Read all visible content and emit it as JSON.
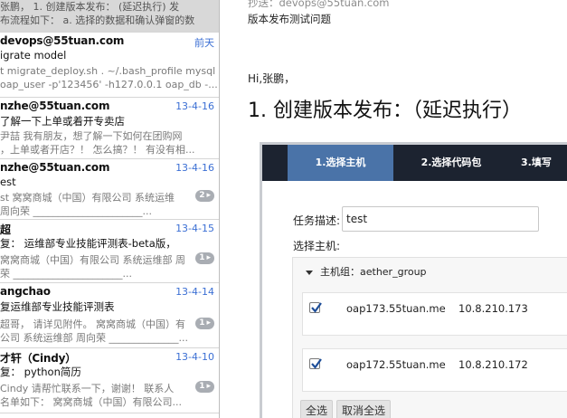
{
  "messages": [
    {
      "from": "",
      "date": "",
      "subject": "",
      "preview": [
        "张鹏， 1. 创建版本发布： (延迟执行) 发",
        "布流程如下： a. 选择的数据和确认弹窗的数"
      ],
      "count": ""
    },
    {
      "from": "devops@55tuan.com",
      "date": "前天",
      "subject": "igrate model",
      "preview": [
        "t migrate_deploy.sh . ~/.bash_profile mysql -",
        "oap_user -p'123456' -h127.0.0.1 oap_db -..."
      ],
      "count": ""
    },
    {
      "from": "nzhe@55tuan.com",
      "date": "13-4-16",
      "subject": "了解一下上单或着开专卖店",
      "preview": [
        "尹喆 我有朋友，想了解一下如何在团购网",
        "，上单或者开店？！ 怎么搞？！ 有没有相..."
      ],
      "count": ""
    },
    {
      "from": "nzhe@55tuan.com",
      "date": "13-4-16",
      "subject": "est",
      "preview": [
        "st 窝窝商城（中国）有限公司 系统运维",
        "周向荣 ______________________..."
      ],
      "count": "2"
    },
    {
      "from": "超",
      "date": "13-4-15",
      "subject": "复： 运维部专业技能评测表-beta版，",
      "preview": [
        "窝窝商城（中国）有限公司 系统运维部 周",
        "荣 ______________________..."
      ],
      "count": "1"
    },
    {
      "from": "angchao",
      "date": "13-4-14",
      "subject": "复运维部专业技能评测表",
      "preview": [
        "超哥， 请详见附件。 窝窝商城（中国）有",
        "公司 系统运维部 周向荣 ______________..."
      ],
      "count": "1"
    },
    {
      "from": "才轩（Cindy）",
      "date": "13-4-10",
      "subject": "复： python简历",
      "preview": [
        "Cindy 请帮忙联系一下，谢谢！ 联系人",
        "名单如下： 窝窝商城（中国）有限公司..."
      ],
      "count": "1"
    }
  ],
  "reader": {
    "cc": "抄送：devops@55tuan.com",
    "subject": "版本发布测试问题",
    "greeting": "Hi,张鹏，",
    "heading": "1. 创建版本发布：（延迟执行）"
  },
  "embedded": {
    "tabs": [
      "1.选择主机",
      "2.选择代码包",
      "3.填写"
    ],
    "active_tab": 0,
    "desc_label": "任务描述:",
    "desc_value": "test",
    "host_label": "选择主机:",
    "group_label": "主机组：aether_group",
    "hosts": [
      {
        "name": "oap173.55tuan.me",
        "ip": "10.8.210.173",
        "checked": true
      },
      {
        "name": "oap172.55tuan.me",
        "ip": "10.8.210.172",
        "checked": true
      }
    ],
    "select_all": "全选",
    "deselect_all": "取消全选"
  },
  "colors": {
    "date": "#3b6fd4",
    "tab_active": "#4a73a8",
    "tab_bar": "#1c2330",
    "selected_row": "#d8d8d8"
  }
}
